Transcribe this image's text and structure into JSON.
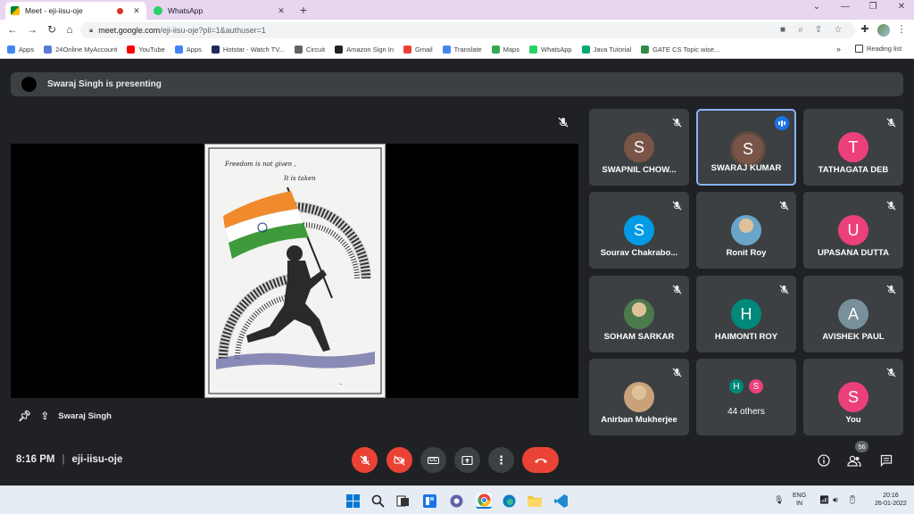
{
  "browser": {
    "tabs": [
      {
        "title": "Meet - eji-iisu-oje",
        "active": true
      },
      {
        "title": "WhatsApp",
        "active": false
      }
    ],
    "url_host": "meet.google.com",
    "url_path": "/eji-iisu-oje?pli=1&authuser=1",
    "bookmarks": [
      {
        "label": "Apps",
        "icon": "apps-grid-icon",
        "color": "#4285f4"
      },
      {
        "label": "24Online MyAccount",
        "icon": "24online-icon",
        "color": "#5a7bd5"
      },
      {
        "label": "YouTube",
        "icon": "youtube-icon",
        "color": "#ff0000"
      },
      {
        "label": "Apps",
        "icon": "apps-grid-icon",
        "color": "#4285f4"
      },
      {
        "label": "Hotstar - Watch TV...",
        "icon": "hotstar-icon",
        "color": "#1f2a5c"
      },
      {
        "label": "Circuit",
        "icon": "globe-icon",
        "color": "#5f6368"
      },
      {
        "label": "Amazon Sign In",
        "icon": "amazon-icon",
        "color": "#222222"
      },
      {
        "label": "Gmail",
        "icon": "gmail-icon",
        "color": "#ea4335"
      },
      {
        "label": "Translate",
        "icon": "translate-icon",
        "color": "#4285f4"
      },
      {
        "label": "Maps",
        "icon": "maps-icon",
        "color": "#34a853"
      },
      {
        "label": "WhatsApp",
        "icon": "whatsapp-icon",
        "color": "#25d366"
      },
      {
        "label": "Java Tutorial",
        "icon": "w3schools-icon",
        "color": "#04aa6d"
      },
      {
        "label": "GATE CS Topic wise...",
        "icon": "gfg-icon",
        "color": "#2f8d46"
      }
    ],
    "overflow": "»",
    "reading_list": "Reading list"
  },
  "meet": {
    "presenting_banner": "Swaraj Singh is presenting",
    "presenter_name": "Swaraj Singh",
    "slide_text_line1": "Freedom is not given ,",
    "slide_text_line2": "It is taken",
    "participants": [
      {
        "name": "SWAPNIL CHOW...",
        "initial": "S",
        "color": "#795548",
        "muted": true,
        "speaking": false,
        "photo": false
      },
      {
        "name": "SWARAJ KUMAR",
        "initial": "S",
        "color": "#795548",
        "muted": false,
        "speaking": true,
        "photo": false
      },
      {
        "name": "TATHAGATA DEB",
        "initial": "T",
        "color": "#ec407a",
        "muted": true,
        "speaking": false,
        "photo": false
      },
      {
        "name": "Sourav Chakrabo...",
        "initial": "S",
        "color": "#039be5",
        "muted": true,
        "speaking": false,
        "photo": false
      },
      {
        "name": "Ronit Roy",
        "initial": "",
        "color": "#6aa5c9",
        "muted": true,
        "speaking": false,
        "photo": true
      },
      {
        "name": "UPASANA DUTTA",
        "initial": "U",
        "color": "#ec407a",
        "muted": true,
        "speaking": false,
        "photo": false
      },
      {
        "name": "SOHAM SARKAR",
        "initial": "",
        "color": "#4d7a4d",
        "muted": true,
        "speaking": false,
        "photo": true
      },
      {
        "name": "HAIMONTI ROY",
        "initial": "H",
        "color": "#00897b",
        "muted": true,
        "speaking": false,
        "photo": false
      },
      {
        "name": "AVISHEK PAUL",
        "initial": "A",
        "color": "#78909c",
        "muted": true,
        "speaking": false,
        "photo": false
      },
      {
        "name": "Anirban Mukherjee",
        "initial": "",
        "color": "#c9a27a",
        "muted": true,
        "speaking": false,
        "photo": true
      },
      {
        "name": "You",
        "initial": "S",
        "color": "#ec407a",
        "muted": true,
        "speaking": false,
        "photo": false
      }
    ],
    "others": {
      "label": "44 others",
      "initials": [
        "H",
        "S"
      ],
      "colors": [
        "#00897b",
        "#ec407a"
      ]
    },
    "time": "8:16 PM",
    "meeting_code": "eji-iisu-oje",
    "people_count": "56"
  },
  "taskbar": {
    "lang_top": "ENG",
    "lang_bottom": "IN",
    "clock_time": "20:16",
    "clock_date": "26-01-2022"
  }
}
